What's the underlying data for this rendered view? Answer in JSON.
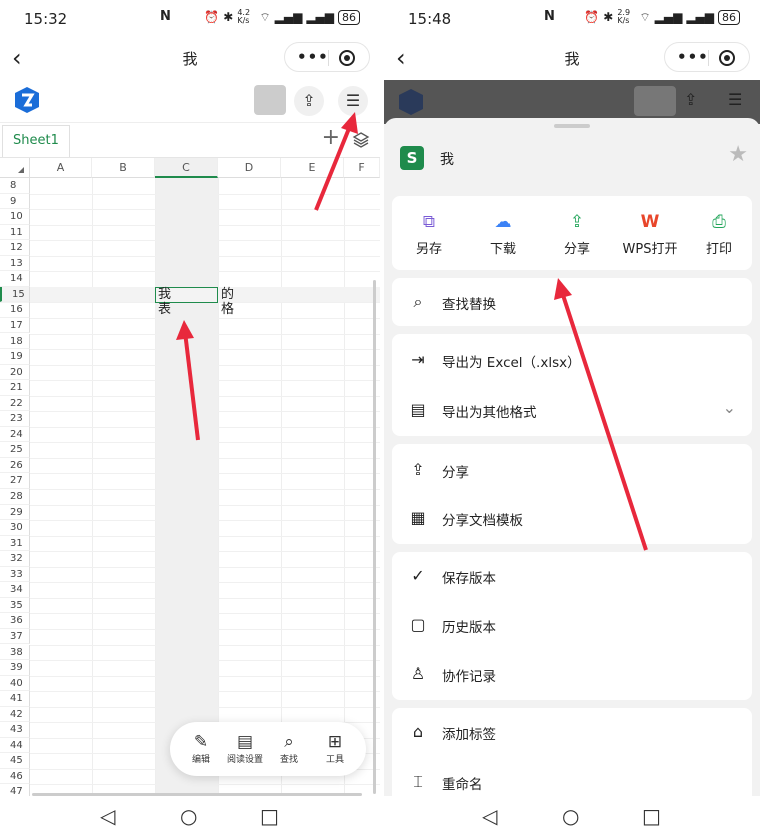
{
  "left": {
    "status": {
      "time": "15:32",
      "nfc": "N",
      "speed": "4.2 K/s",
      "battery": "86"
    },
    "nav": {
      "back": "‹",
      "title": "我",
      "more": "•••"
    },
    "sheet_tab": "Sheet1",
    "columns": [
      "A",
      "B",
      "C",
      "D",
      "E",
      "F"
    ],
    "rows": [
      "8",
      "9",
      "10",
      "11",
      "12",
      "13",
      "14",
      "15",
      "16",
      "17",
      "18",
      "19",
      "20",
      "21",
      "22",
      "23",
      "24",
      "25",
      "26",
      "27",
      "28",
      "29",
      "30",
      "31",
      "32",
      "33",
      "34",
      "35",
      "36",
      "37",
      "38",
      "39",
      "40",
      "41",
      "42",
      "43",
      "44",
      "45",
      "46",
      "47"
    ],
    "cells": {
      "c15": "我",
      "d15": "的",
      "c16": "表",
      "d16": "格"
    },
    "floatbar": [
      {
        "label": "编辑",
        "icon": "pencil-icon"
      },
      {
        "label": "阅读设置",
        "icon": "read-settings-icon"
      },
      {
        "label": "查找",
        "icon": "search-icon"
      },
      {
        "label": "工具",
        "icon": "tools-grid-icon"
      }
    ]
  },
  "right": {
    "status": {
      "time": "15:48",
      "nfc": "N",
      "speed": "2.9 K/s",
      "battery": "86"
    },
    "nav": {
      "back": "‹",
      "title": "我",
      "more": "•••"
    },
    "doc": {
      "icon_letter": "S",
      "title": "我"
    },
    "actions": [
      {
        "label": "另存",
        "icon": "save-as-icon",
        "color": "#7b5cd6"
      },
      {
        "label": "下载",
        "icon": "cloud-download-icon",
        "color": "#3b82f6"
      },
      {
        "label": "分享",
        "icon": "share-icon",
        "color": "#22a55a"
      },
      {
        "label": "WPS打开",
        "icon": "wps-icon",
        "color": "#e8462b"
      },
      {
        "label": "打印",
        "icon": "printer-icon",
        "color": "#22a55a"
      }
    ],
    "menu": {
      "find_replace": "查找替换",
      "export_excel": "导出为 Excel（.xlsx）",
      "export_other": "导出为其他格式",
      "share": "分享",
      "share_template": "分享文档模板",
      "save_version": "保存版本",
      "history": "历史版本",
      "collab": "协作记录",
      "add_tag": "添加标签",
      "rename": "重命名"
    }
  },
  "colors": {
    "accent_green": "#1f8b4c",
    "arrow_red": "#e8283c"
  }
}
